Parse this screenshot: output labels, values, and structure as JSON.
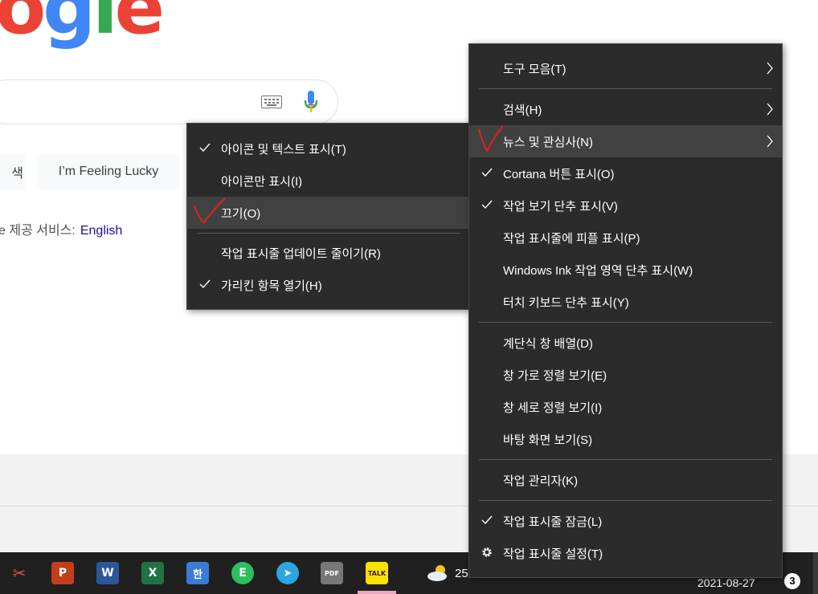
{
  "google": {
    "logo_letters": [
      "o",
      "g",
      "l",
      "e"
    ],
    "lucky_button": "I’m Feeling Lucky",
    "search_button_fragment": "색",
    "offered_in_prefix": "e 제공 서비스:",
    "offered_in_lang": "English"
  },
  "main_menu": {
    "items": [
      {
        "label": "도구 모음(T)",
        "checked": false,
        "submenu": true
      },
      {
        "label": "검색(H)",
        "checked": false,
        "submenu": true
      },
      {
        "label": "뉴스 및 관심사(N)",
        "checked": false,
        "submenu": true,
        "highlighted": true
      },
      {
        "label": "Cortana 버튼 표시(O)",
        "checked": true
      },
      {
        "label": "작업 보기 단추 표시(V)",
        "checked": true
      },
      {
        "label": "작업 표시줄에 피플 표시(P)",
        "checked": false
      },
      {
        "label": "Windows Ink 작업 영역 단추 표시(W)",
        "checked": false
      },
      {
        "label": "터치 키보드 단추 표시(Y)",
        "checked": false
      },
      {
        "label": "계단식 창 배열(D)",
        "checked": false
      },
      {
        "label": "창 가로 정렬 보기(E)",
        "checked": false
      },
      {
        "label": "창 세로 정렬 보기(I)",
        "checked": false
      },
      {
        "label": "바탕 화면 보기(S)",
        "checked": false
      },
      {
        "label": "작업 관리자(K)",
        "checked": false
      },
      {
        "label": "작업 표시줄 잠금(L)",
        "checked": true
      },
      {
        "label": "작업 표시줄 설정(T)",
        "icon": "gear-icon"
      }
    ]
  },
  "sub_menu": {
    "items": [
      {
        "label": "아이콘 및 텍스트 표시(T)",
        "checked": true
      },
      {
        "label": "아이콘만 표시(I)",
        "checked": false
      },
      {
        "label": "끄기(O)",
        "checked": false,
        "highlighted": true
      },
      {
        "label": "작업 표시줄 업데이트 줄이기(R)",
        "checked": false
      },
      {
        "label": "가리킨 항목 열기(H)",
        "checked": true
      }
    ]
  },
  "taskbar": {
    "apps": [
      {
        "name": "snipping-tool-icon",
        "glyph": "✂",
        "color": "#d9534f"
      },
      {
        "name": "powerpoint-icon",
        "glyph": "P",
        "color": "#c43e1c"
      },
      {
        "name": "word-icon",
        "glyph": "W",
        "color": "#2b579a"
      },
      {
        "name": "excel-icon",
        "glyph": "X",
        "color": "#217346"
      },
      {
        "name": "hangul-icon",
        "glyph": "한",
        "color": "#3a7bd5"
      },
      {
        "name": "evernote-icon",
        "glyph": "E",
        "color": "#2dbe60"
      },
      {
        "name": "telegram-icon",
        "glyph": "➤",
        "color": "#2ca5e0"
      },
      {
        "name": "pdf-icon",
        "glyph": "PDF",
        "color": "#777777"
      },
      {
        "name": "kakaotalk-icon",
        "glyph": "TALK",
        "color": "#fae100"
      }
    ],
    "weather_temp": "25",
    "date": "2021-08-27",
    "notification_count": "3"
  },
  "colors": {
    "menu_bg": "#2b2b2b",
    "menu_highlight": "#414141",
    "taskbar_bg": "#202020",
    "red_annotation": "#e02020"
  }
}
